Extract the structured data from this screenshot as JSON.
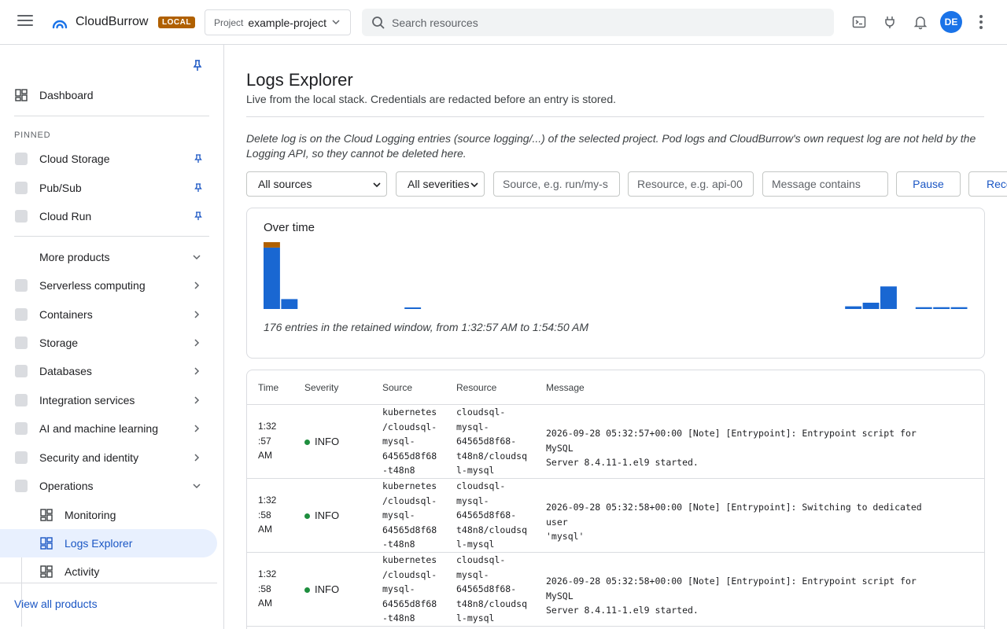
{
  "topbar": {
    "brand": "CloudBurrow",
    "badge": "LOCAL",
    "project_label": "Project",
    "project_value": "example-project",
    "search_placeholder": "Search resources",
    "avatar_initials": "DE"
  },
  "sidebar": {
    "dashboard": "Dashboard",
    "pinned_label": "PINNED",
    "pinned": [
      {
        "label": "Cloud Storage"
      },
      {
        "label": "Pub/Sub"
      },
      {
        "label": "Cloud Run"
      }
    ],
    "more_products": "More products",
    "categories": [
      {
        "label": "Serverless computing"
      },
      {
        "label": "Containers"
      },
      {
        "label": "Storage"
      },
      {
        "label": "Databases"
      },
      {
        "label": "Integration services"
      },
      {
        "label": "AI and machine learning"
      },
      {
        "label": "Security and identity"
      },
      {
        "label": "Operations"
      }
    ],
    "operations_items": [
      {
        "label": "Monitoring"
      },
      {
        "label": "Logs Explorer",
        "active": true
      },
      {
        "label": "Activity"
      }
    ],
    "view_all": "View all products"
  },
  "main": {
    "title": "Logs Explorer",
    "subtitle": "Live from the local stack. Credentials are redacted before an entry is stored.",
    "note": "Delete log is on the Cloud Logging entries (source logging/...) of the selected project. Pod logs and CloudBurrow's own request log are not held by the Logging API, so they cannot be deleted here.",
    "filters": {
      "source_select": "All sources",
      "severity_select": "All severities",
      "source_placeholder": "Source, e.g. run/my-s",
      "resource_placeholder": "Resource, e.g. api-00",
      "message_placeholder": "Message contains",
      "pause_label": "Pause",
      "record_label": "Reco"
    },
    "chart_title": "Over time",
    "chart_footer": "176 entries in the retained window, from 1:32:57 AM to 1:54:50 AM",
    "table": {
      "headers": [
        "Time",
        "Severity",
        "Source",
        "Resource",
        "Message"
      ],
      "rows": [
        {
          "time": "1:32:57 AM",
          "time_lines": [
            "1:32",
            ":57",
            "AM"
          ],
          "severity": "INFO",
          "source_lines": [
            "kubernetes",
            "/cloudsql-",
            "mysql-",
            "64565d8f68",
            "-t48n8"
          ],
          "resource_lines": [
            "cloudsql-",
            "mysql-",
            "64565d8f68-",
            "t48n8/cloudsq",
            "l-mysql"
          ],
          "message_lines": [
            "2026-09-28 05:32:57+00:00 [Note] [Entrypoint]: Entrypoint script for MySQL",
            "Server 8.4.11-1.el9 started."
          ]
        },
        {
          "time": "1:32:58 AM",
          "time_lines": [
            "1:32",
            ":58",
            "AM"
          ],
          "severity": "INFO",
          "source_lines": [
            "kubernetes",
            "/cloudsql-",
            "mysql-",
            "64565d8f68",
            "-t48n8"
          ],
          "resource_lines": [
            "cloudsql-",
            "mysql-",
            "64565d8f68-",
            "t48n8/cloudsq",
            "l-mysql"
          ],
          "message_lines": [
            "2026-09-28 05:32:58+00:00 [Note] [Entrypoint]: Switching to dedicated user",
            "'mysql'"
          ]
        },
        {
          "time": "1:32:58 AM",
          "time_lines": [
            "1:32",
            ":58",
            "AM"
          ],
          "severity": "INFO",
          "source_lines": [
            "kubernetes",
            "/cloudsql-",
            "mysql-",
            "64565d8f68",
            "-t48n8"
          ],
          "resource_lines": [
            "cloudsql-",
            "mysql-",
            "64565d8f68-",
            "t48n8/cloudsq",
            "l-mysql"
          ],
          "message_lines": [
            "2026-09-28 05:32:58+00:00 [Note] [Entrypoint]: Entrypoint script for MySQL",
            "Server 8.4.11-1.el9 started."
          ]
        }
      ]
    }
  },
  "chart_data": {
    "type": "bar",
    "title": "Over time",
    "stacked": true,
    "bucket_count": 40,
    "series": [
      {
        "name": "INFO",
        "color": "#1967d2",
        "values": [
          68,
          11,
          0,
          0,
          0,
          0,
          0,
          0,
          1,
          0,
          0,
          0,
          0,
          0,
          0,
          0,
          0,
          0,
          0,
          0,
          0,
          0,
          0,
          0,
          0,
          0,
          0,
          0,
          0,
          0,
          0,
          0,
          0,
          3,
          7,
          25,
          0,
          2,
          2,
          2
        ]
      },
      {
        "name": "WARNING",
        "color": "#b06000",
        "values": [
          6,
          0,
          0,
          0,
          0,
          0,
          0,
          0,
          0,
          0,
          0,
          0,
          0,
          0,
          0,
          0,
          0,
          0,
          0,
          0,
          0,
          0,
          0,
          0,
          0,
          0,
          0,
          0,
          0,
          0,
          0,
          0,
          0,
          0,
          0,
          0,
          0,
          0,
          0,
          0
        ]
      }
    ],
    "grid": false,
    "legend": "none"
  }
}
